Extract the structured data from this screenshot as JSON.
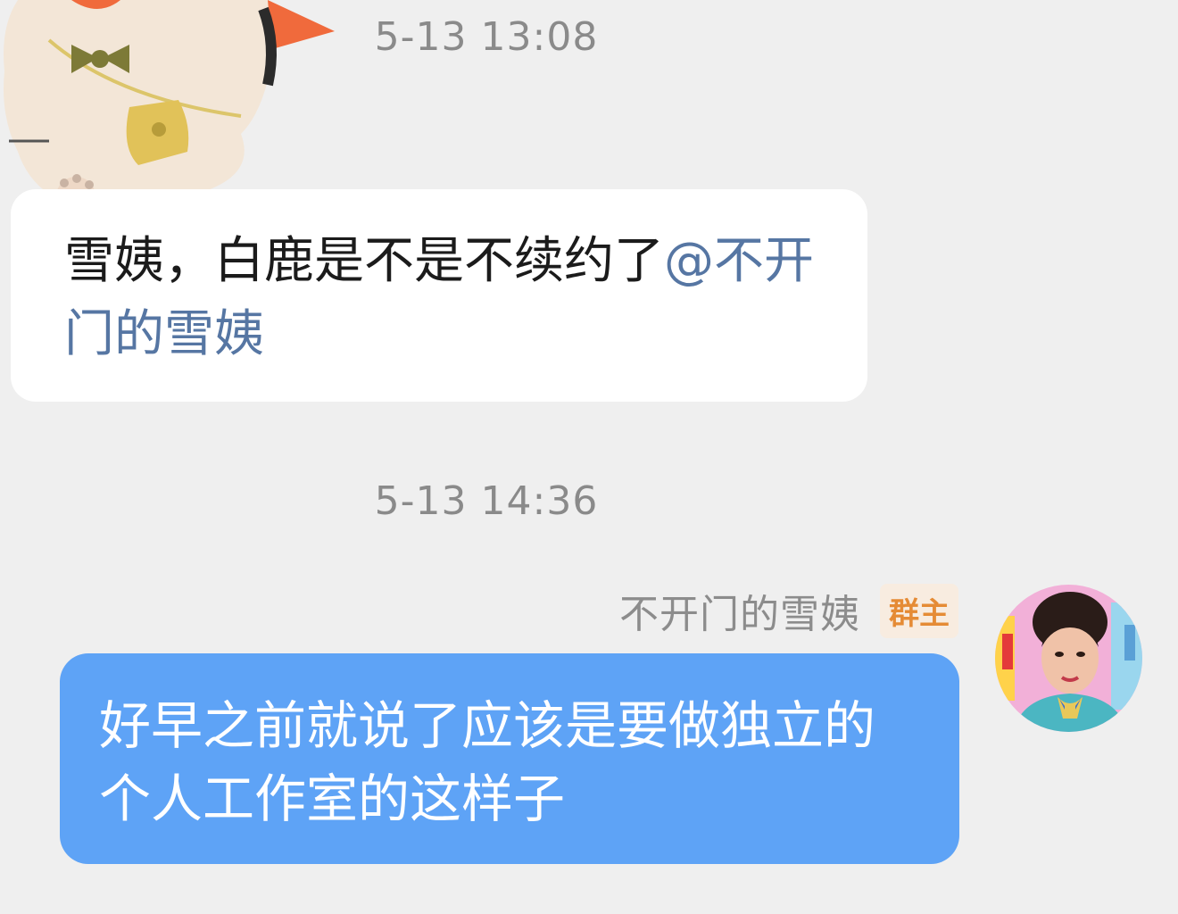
{
  "chat": {
    "messages": [
      {
        "timestamp": "5-13 13:08",
        "text": "雪姨，白鹿是不是不续约了",
        "mention": "@不开门的雪姨"
      },
      {
        "timestamp": "5-13 14:36",
        "sender": "不开门的雪姨",
        "badge": "群主",
        "text": "好早之前就说了应该是要做独立的个人工作室的这样子"
      }
    ]
  },
  "colors": {
    "background": "#efefef",
    "incoming_bubble": "#ffffff",
    "outgoing_bubble": "#5ea3f6",
    "mention": "#5676a3",
    "badge_text": "#e58b35",
    "badge_bg": "#f8ece0"
  },
  "icons": {
    "sticker": "cartoon-cat-sticker-icon",
    "avatar": "user-avatar"
  }
}
